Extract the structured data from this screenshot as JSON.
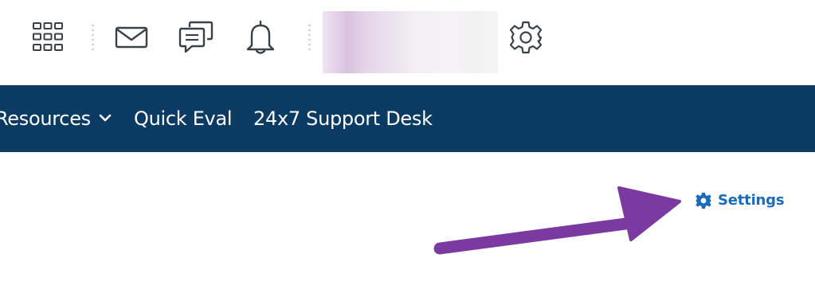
{
  "topbar": {
    "icons": {
      "apps": "grid-icon",
      "mail": "mail-icon",
      "chat": "chat-icon",
      "notifications": "bell-icon",
      "settings": "gear-icon"
    }
  },
  "navbar": {
    "items": [
      {
        "label": "Resources",
        "has_dropdown": true
      },
      {
        "label": "Quick Eval"
      },
      {
        "label": "24x7 Support Desk"
      }
    ],
    "background": "#0b3b62"
  },
  "content": {
    "settings_label": "Settings",
    "settings_icon": "gear-icon",
    "link_color": "#1a6bb8",
    "annotation_arrow_color": "#7a3aa0"
  }
}
